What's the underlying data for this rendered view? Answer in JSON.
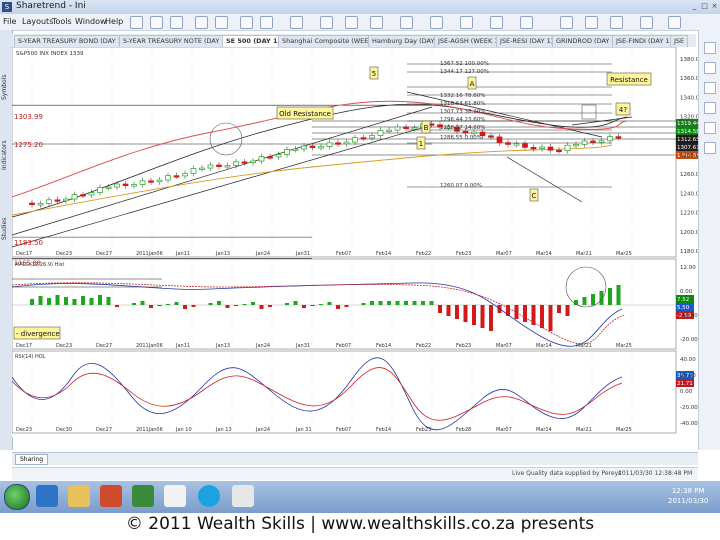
{
  "window": {
    "title": "Sharetrend - Ini",
    "menu": [
      "File",
      "Layouts",
      "Tools",
      "Window",
      "Help"
    ]
  },
  "tabs": [
    {
      "label": "S-YEAR TREASURY BOND (DAY 1)",
      "active": false
    },
    {
      "label": "S-YEAR TREASURY NOTE (DAY 1)",
      "active": false
    },
    {
      "label": "SE 500 (DAY 1)",
      "active": true
    },
    {
      "label": "Shanghai Composite (WEEK 1)",
      "active": false
    },
    {
      "label": "Hamburg Day (DAY 1)",
      "active": false
    },
    {
      "label": "JSE-AGSH (WEEK 1)",
      "active": false
    },
    {
      "label": "JSE-RESI (DAY 1)",
      "active": false
    },
    {
      "label": "GRINDROD (DAY 1)",
      "active": false
    },
    {
      "label": "JSE-FINDI (DAY 1)",
      "active": false
    },
    {
      "label": "JSE",
      "active": false
    }
  ],
  "left_panel": {
    "labels": [
      "Symbols",
      "Indicators",
      "Studies"
    ]
  },
  "chart": {
    "header": "S&P500 INX INDEX 1339",
    "left_price_labels": [
      "1303.99",
      "1275.20",
      "1183.50",
      "1165.88"
    ],
    "right_axis": [
      "1380.00",
      "1360.00",
      "1340.00",
      "1320.00",
      "1300.00",
      "1280.00",
      "1260.00",
      "1240.00",
      "1220.00",
      "1200.00",
      "1180.00"
    ],
    "current_labels": [
      "1319.44",
      "1314.58",
      "1312.65",
      "1307.61",
      "1294.65"
    ],
    "fib_labels": [
      "1367.52 100.00%",
      "1344.17 127.00%",
      "1332.16 78.60%",
      "1318.64 61.80%",
      "1307.73 38.20%",
      "1296.44 23.60%",
      "1288.27 14.60%",
      "1286.55 0.00%",
      "1260.07 0.00%"
    ],
    "annotations": {
      "old_resistance": "Old Resistance",
      "resistance": "Resistance",
      "wave_5": "5",
      "wave_a": "A",
      "wave_1": "1",
      "wave_b": "B",
      "wave_c": "C",
      "wave_4": "4?"
    },
    "x_labels": [
      "Dec17",
      "Dec23",
      "Dec27",
      "2011Jan06",
      "Jan11",
      "Jan13",
      "Jan24",
      "Jan31",
      "Feb07",
      "Feb14",
      "Feb22",
      "Feb23",
      "Mar07",
      "Mar14",
      "Mar21",
      "Mar25"
    ],
    "macd_header": "MACD(12,26,9) Hist",
    "macd_axis": [
      "12.00",
      "0.00",
      "-10.00",
      "-20.00"
    ],
    "macd_current": [
      "7.52",
      "5.50",
      "-2.59"
    ],
    "divergence_label": "- divergence",
    "rsi_header": "RSI(14) HOL",
    "rsi_axis": [
      "40.00",
      "20.00",
      "0.00",
      "-20.00",
      "-40.00"
    ],
    "rsi_current": [
      "35.73",
      "21.71"
    ],
    "x_labels_bottom": [
      "Dec23",
      "Dec30",
      "Dec27",
      "2011Jan06",
      "Jan 10",
      "Jan 13",
      "Jan24",
      "Jan 31",
      "Feb07",
      "Feb14",
      "Feb23",
      "Feb28",
      "Mar07",
      "Mar14",
      "Mar21",
      "Mar25"
    ]
  },
  "status": {
    "tab": "Sharing",
    "left": "Live Quality data supplied by Pereys",
    "right": "2011/03/30 12:38:48 PM",
    "time": "12:38 PM",
    "date": "2011/03/30"
  },
  "footer": "© 2011 Wealth Skills | www.wealthskills.co.za presents",
  "colors": {
    "up": "#1fa51f",
    "down": "#d21a1a",
    "ma_red": "#e04a4a",
    "ma_orange": "#d89a1c",
    "ma_black": "#222222",
    "label_bg": "#fff59a"
  }
}
